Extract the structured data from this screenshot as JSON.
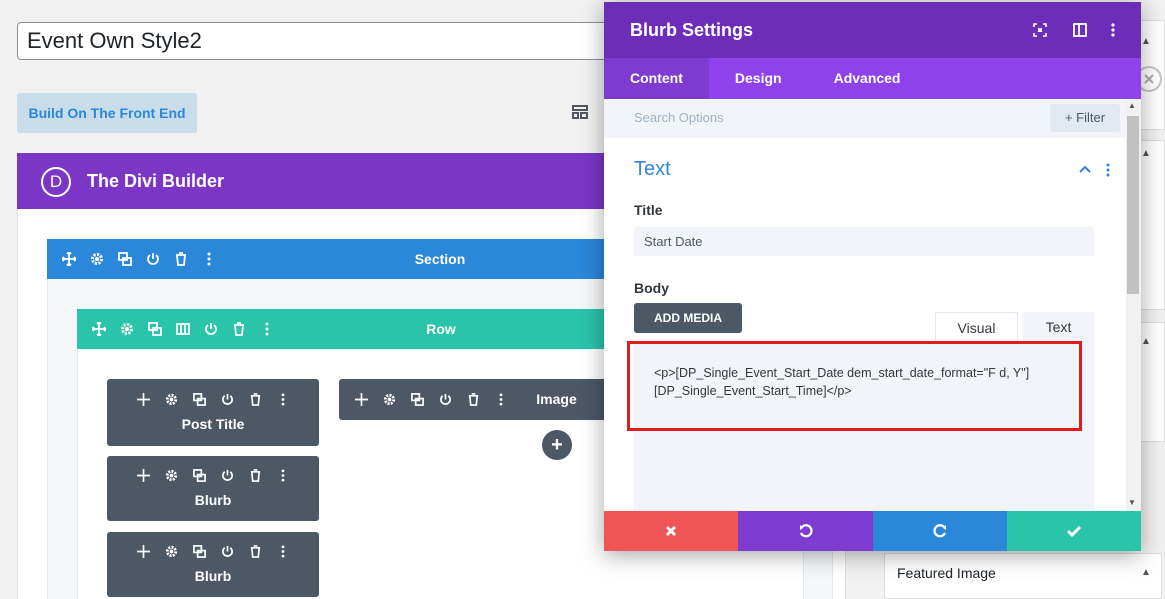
{
  "post": {
    "title_value": "Event Own Style2",
    "build_front_label": "Build On The Front End"
  },
  "builder": {
    "logo_letter": "D",
    "title": "The Divi Builder",
    "section_label": "Section",
    "row_label": "Row",
    "modules": [
      {
        "label": "Post Title"
      },
      {
        "label": "Blurb"
      },
      {
        "label": "Blurb"
      },
      {
        "label": "Image"
      }
    ],
    "add_symbol": "+"
  },
  "sidebar": {
    "featured_image_label": "Featured Image"
  },
  "modal": {
    "title": "Blurb Settings",
    "tabs": [
      {
        "label": "Content",
        "active": true
      },
      {
        "label": "Design",
        "active": false
      },
      {
        "label": "Advanced",
        "active": false
      }
    ],
    "search_placeholder": "Search Options",
    "filter_label": "+ Filter",
    "group_title": "Text",
    "title_field": {
      "label": "Title",
      "value": "Start Date"
    },
    "body_field": {
      "label": "Body",
      "add_media_label": "ADD MEDIA",
      "editor_tabs": [
        "Visual",
        "Text"
      ],
      "content": "<p>[DP_Single_Event_Start_Date dem_start_date_format=\"F d, Y\"][DP_Single_Event_Start_Time]</p>"
    },
    "footer_colors": {
      "cancel": "#ef5555",
      "undo": "#7e3bd0",
      "redo": "#2b87da",
      "save": "#29c4a9"
    }
  },
  "colors": {
    "divi_purple": "#7b36c6",
    "section_blue": "#2b87da",
    "row_teal": "#29c4a9",
    "module_gray": "#4c5866",
    "highlight_red": "#e21b1b"
  }
}
